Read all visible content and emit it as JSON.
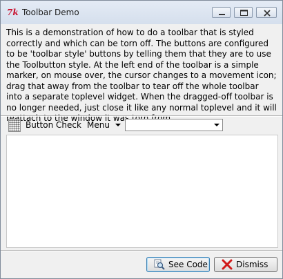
{
  "window": {
    "title": "Toolbar Demo"
  },
  "description": "This is a demonstration of how to do a toolbar that is styled correctly and which can be torn off. The buttons are configured to be 'toolbar style' buttons by telling them that they are to use the Toolbutton style. At the left end of the toolbar is a simple marker, on mouse over, the cursor changes to a movement icon; drag that away from the toolbar to tear off the whole toolbar into a separate toplevel widget. When the dragged-off toolbar is no longer needed, just close it like any normal toplevel and it will reattach to the window it was torn from.",
  "toolbar": {
    "button_label": "Button",
    "check_label": "Check",
    "menu_label": "Menu",
    "combo_value": ""
  },
  "text_area": {
    "content": ""
  },
  "buttons": {
    "see_code": "See Code",
    "dismiss": "Dismiss"
  },
  "icons": {
    "app": "tk-feather-icon",
    "see_code": "magnifier-icon",
    "dismiss": "red-x-icon"
  },
  "colors": {
    "titlebar": "#d5dfed",
    "dismiss_icon": "#d11a1a",
    "default_button_border": "#3c7fb1"
  }
}
